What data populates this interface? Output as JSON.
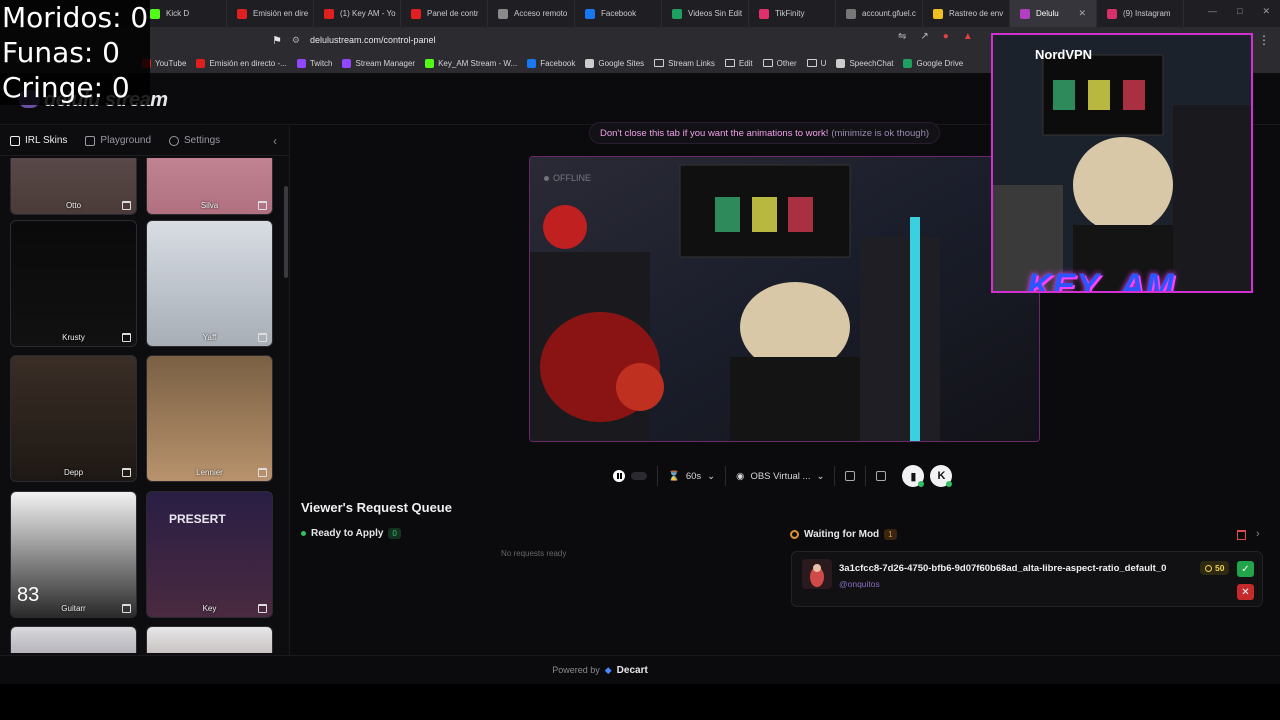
{
  "overlay": {
    "line1": "Moridos: 0",
    "line2": "Funas: 0",
    "line3": "Cringe: 0"
  },
  "browser": {
    "tabs": [
      {
        "label": "Kick D",
        "color": "#53fc18"
      },
      {
        "label": "Emisión en dire",
        "color": "#e02020"
      },
      {
        "label": "(1) Key AM - Yo",
        "color": "#e02020"
      },
      {
        "label": "Panel de contr",
        "color": "#e02020"
      },
      {
        "label": "Acceso remoto",
        "color": "#8a8a8a"
      },
      {
        "label": "Facebook",
        "color": "#1877f2"
      },
      {
        "label": "Videos Sin Edit",
        "color": "#20a060"
      },
      {
        "label": "TikFinity",
        "color": "#e0306a"
      },
      {
        "label": "account.gfuel.c",
        "color": "#777777"
      },
      {
        "label": "Rastreo de env",
        "color": "#f0c020"
      },
      {
        "label": "Delulu",
        "color": "#b040c0",
        "active": true
      },
      {
        "label": "(9) Instagram",
        "color": "#d6306a"
      }
    ],
    "url": "delulustream.com/control-panel",
    "bookmarks": [
      {
        "label": "YouTube",
        "color": "#e02020"
      },
      {
        "label": "Emisión en directo -...",
        "color": "#e02020"
      },
      {
        "label": "Twitch",
        "color": "#9146ff"
      },
      {
        "label": "Stream Manager",
        "color": "#9146ff"
      },
      {
        "label": "Key_AM Stream - W...",
        "color": "#53fc18"
      },
      {
        "label": "Facebook",
        "color": "#1877f2"
      },
      {
        "label": "Google Sites",
        "color": "#cccccc"
      },
      {
        "label": "Stream Links",
        "folder": true
      },
      {
        "label": "Edit",
        "folder": true
      },
      {
        "label": "Other",
        "folder": true
      },
      {
        "label": "U",
        "folder": true
      },
      {
        "label": "SpeechChat",
        "color": "#cccccc"
      },
      {
        "label": "Google Drive",
        "color": "#20a060"
      }
    ]
  },
  "app": {
    "logo": "delulu stream",
    "sidebar": {
      "tabs": [
        "IRL Skins",
        "Playground",
        "Settings"
      ],
      "skins": [
        {
          "name": "Otto",
          "bg": "linear-gradient(#6a5a5a,#4a3a38)"
        },
        {
          "name": "Silva",
          "bg": "linear-gradient(#d49aa6,#b07080)"
        },
        {
          "name": "Krusty",
          "bg": "linear-gradient(#0a0a0a,#111)"
        },
        {
          "name": "Yaff",
          "bg": "linear-gradient(#d8dde4,#a8aeb6)"
        },
        {
          "name": "Depp",
          "bg": "linear-gradient(#3a2e26,#1e1814)"
        },
        {
          "name": "Lennier",
          "bg": "linear-gradient(#7a6044,#b8926c)"
        },
        {
          "name": "Guitarr",
          "bg": "linear-gradient(#f2f2f2,#2a2a2a)"
        },
        {
          "name": "Key",
          "bg": "linear-gradient(#2a1e44,#4a2a40)"
        },
        {
          "name": "",
          "bg": "linear-gradient(#d8d8dc,#3a3040)"
        },
        {
          "name": "",
          "bg": "linear-gradient(#e6e6e8,#5a4030)"
        }
      ],
      "guitarr_badge": "83",
      "key_badge": "PRESERT"
    },
    "notice": {
      "main": "Don't close this tab if you want the animations to work!",
      "sub": "(minimize is ok though)"
    },
    "preview": {
      "status": "OFFLINE"
    },
    "controls": {
      "duration": "60s",
      "camera": "OBS Virtual ..."
    },
    "queue": {
      "title": "Viewer's Request Queue",
      "ready_label": "Ready to Apply",
      "ready_count": "0",
      "empty_text": "No requests ready",
      "waiting_label": "Waiting for Mod",
      "waiting_count": "1",
      "requests": [
        {
          "name": "3a1cfcc8-7d26-4750-bfb6-9d07f60b68ad_alta-libre-aspect-ratio_default_0",
          "user": "@onquitos",
          "cost": "50"
        }
      ]
    },
    "footer": {
      "powered": "Powered by",
      "brand": "Decart"
    }
  },
  "cam": {
    "vpn": "NordVPN",
    "title": "KEY_AM"
  }
}
